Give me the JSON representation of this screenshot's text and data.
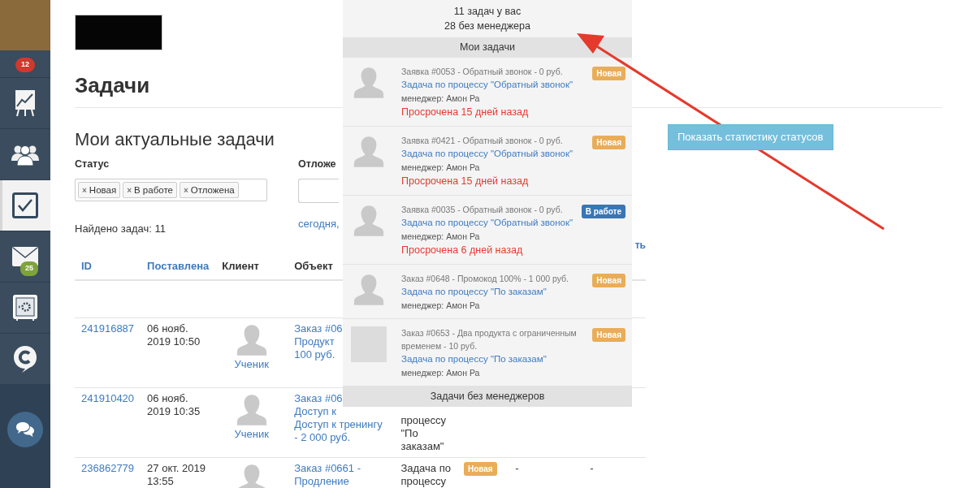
{
  "sidebar": {
    "items": [
      {
        "kind": "profile",
        "badge": "12",
        "selected": false
      },
      {
        "kind": "chart",
        "selected": false
      },
      {
        "kind": "people",
        "selected": false
      },
      {
        "kind": "tasks",
        "selected": true
      },
      {
        "kind": "mail",
        "badge": "25",
        "selected": false
      },
      {
        "kind": "safe",
        "selected": false
      },
      {
        "kind": "chat-logo",
        "selected": false
      }
    ]
  },
  "page": {
    "title": "Задачи",
    "subtitle": "Мои актуальные задачи",
    "stats_button": "Показать статистику статусов"
  },
  "filters": {
    "status": {
      "label": "Статус",
      "remove_icon": "×",
      "tokens": [
        "Новая",
        "В работе",
        "Отложена"
      ]
    },
    "postponed": {
      "label": "Отложе",
      "link": "сегодня,"
    }
  },
  "found": "Найдено задач: 11",
  "reset_link": "ть",
  "table": {
    "columns": [
      {
        "label": "ID",
        "sortable": true
      },
      {
        "label": "Поставлена",
        "sortable": true
      },
      {
        "label": "Клиент",
        "sortable": false
      },
      {
        "label": "Объект",
        "sortable": false
      }
    ],
    "rows": [
      {
        "id": "241916887",
        "date": [
          "06 нояб.",
          "2019 10:50"
        ],
        "client": "Ученик",
        "object": [
          "Заказ #06",
          "Продукт",
          "100 руб."
        ]
      },
      {
        "id": "241910420",
        "date": [
          "06 нояб.",
          "2019 10:35"
        ],
        "client": "Ученик",
        "object": [
          "Заказ #06",
          "Доступ к",
          "Доступ к тренингу",
          "- 2 000 руб."
        ],
        "process": [
          "процессу",
          "\"По",
          "заказам\""
        ]
      },
      {
        "id": "236862779",
        "date": [
          "27 окт. 2019",
          "13:55"
        ],
        "object": [
          "Заказ #0661 -",
          "Продление"
        ],
        "process": [
          "Задача по",
          "процессу"
        ],
        "status": {
          "label": "Новая",
          "kind": "new"
        },
        "column_7": "-",
        "column_8": "-"
      }
    ]
  },
  "popup": {
    "summary": [
      "11 задач у вас",
      "28 без менеджера"
    ],
    "my_section": "Мои задачи",
    "footer_section": "Задачи без менеджеров",
    "items": [
      {
        "kind": "silhouette",
        "source": "Заявка #0053 - Обратный звонок - 0 руб.",
        "title": "Задача по процессу \"Обратный звонок\"",
        "manager": "менеджер: Амон Ра",
        "overdue": "Просрочена 15 дней назад",
        "status": {
          "label": "Новая",
          "kind": "new"
        }
      },
      {
        "kind": "silhouette",
        "source": "Заявка #0421 - Обратный звонок - 0 руб.",
        "title": "Задача по процессу \"Обратный звонок\"",
        "manager": "менеджер: Амон Ра",
        "overdue": "Просрочена 15 дней назад",
        "status": {
          "label": "Новая",
          "kind": "new"
        }
      },
      {
        "kind": "silhouette",
        "source": "Заявка #0035 - Обратный звонок - 0 руб.",
        "title": "Задача по процессу \"Обратный звонок\"",
        "manager": "менеджер: Амон Ра",
        "overdue": "Просрочена 6 дней назад",
        "status": {
          "label": "В работе",
          "kind": "in_progress"
        }
      },
      {
        "kind": "silhouette",
        "source": "Заказ #0648 - Промокод 100% - 1 000 руб.",
        "title": "Задача по процессу \"По заказам\"",
        "manager": "менеджер: Амон Ра",
        "status": {
          "label": "Новая",
          "kind": "new"
        }
      },
      {
        "kind": "photo",
        "source": "Заказ #0653 - Два продукта с ограниченным временем - 10 руб.",
        "title": "Задача по процессу \"По заказам\"",
        "manager": "менеджер: Амон Ра",
        "status": {
          "label": "Новая",
          "kind": "new"
        }
      }
    ]
  }
}
